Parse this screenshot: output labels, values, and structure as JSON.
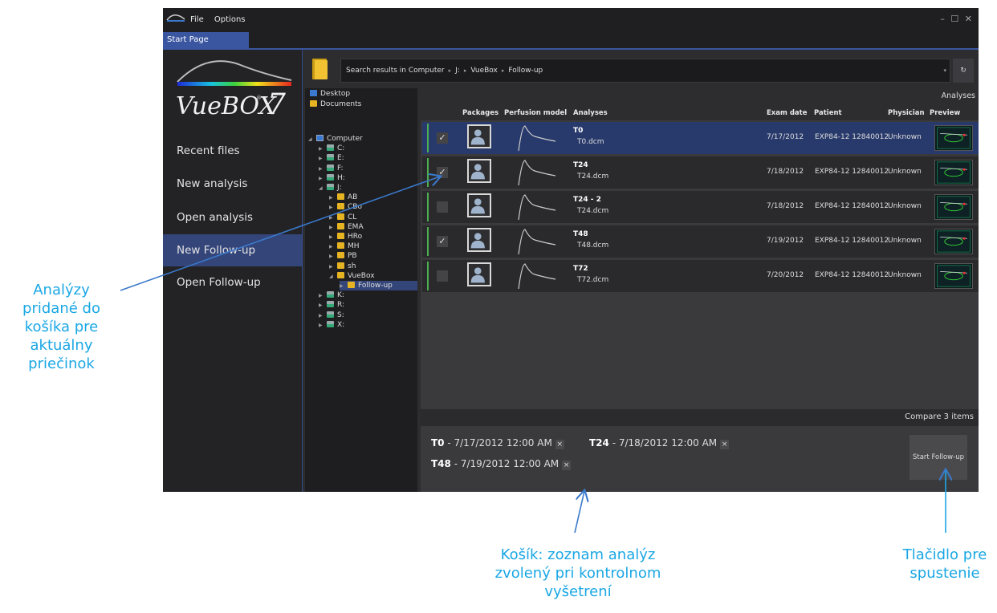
{
  "app": {
    "menu": [
      "File",
      "Options"
    ],
    "window_controls": "– ☐ ✕",
    "tab": "Start Page"
  },
  "brand": {
    "name": "VueBOX",
    "version": "7",
    "registered": "®"
  },
  "nav": {
    "items": [
      "Recent files",
      "New analysis",
      "Open analysis",
      "New Follow-up",
      "Open Follow-up"
    ],
    "active": "New Follow-up"
  },
  "path": {
    "segments": [
      "Search results in Computer",
      "J:",
      "VueBox",
      "Follow-up"
    ],
    "dropdown_glyph": "▾",
    "refresh_glyph": "↻"
  },
  "tree": {
    "items": [
      {
        "label": "Desktop",
        "icon": "desktop-icon",
        "level": 0,
        "arrow": ""
      },
      {
        "label": "Documents",
        "icon": "folder-icon",
        "level": 0,
        "arrow": ""
      },
      {
        "label": "Computer",
        "icon": "computer-icon",
        "level": 0,
        "arrow": "◢"
      },
      {
        "label": "C:",
        "icon": "drive-icon",
        "level": 1,
        "arrow": "▶"
      },
      {
        "label": "E:",
        "icon": "disc-icon",
        "level": 1,
        "arrow": "▶"
      },
      {
        "label": "F:",
        "icon": "drive-icon",
        "level": 1,
        "arrow": "▶"
      },
      {
        "label": "H:",
        "icon": "network-drive-icon",
        "level": 1,
        "arrow": "▶"
      },
      {
        "label": "J:",
        "icon": "network-drive-icon",
        "level": 1,
        "arrow": "◢"
      },
      {
        "label": "AB",
        "icon": "folder-icon",
        "level": 2,
        "arrow": "▶"
      },
      {
        "label": "CBo",
        "icon": "folder-icon",
        "level": 2,
        "arrow": "▶"
      },
      {
        "label": "CL",
        "icon": "folder-icon",
        "level": 2,
        "arrow": "▶"
      },
      {
        "label": "EMA",
        "icon": "folder-icon",
        "level": 2,
        "arrow": "▶"
      },
      {
        "label": "HRo",
        "icon": "folder-icon",
        "level": 2,
        "arrow": "▶"
      },
      {
        "label": "MH",
        "icon": "folder-icon",
        "level": 2,
        "arrow": "▶"
      },
      {
        "label": "PB",
        "icon": "folder-icon",
        "level": 2,
        "arrow": "▶"
      },
      {
        "label": "sh",
        "icon": "folder-icon",
        "level": 2,
        "arrow": "▶"
      },
      {
        "label": "VueBox",
        "icon": "folder-icon",
        "level": 2,
        "arrow": "◢"
      },
      {
        "label": "Follow-up",
        "icon": "folder-icon",
        "level": 3,
        "arrow": "▶",
        "selected": true
      },
      {
        "label": "K:",
        "icon": "network-drive-icon",
        "level": 1,
        "arrow": "▶"
      },
      {
        "label": "R:",
        "icon": "network-drive-icon",
        "level": 1,
        "arrow": "▶"
      },
      {
        "label": "S:",
        "icon": "network-drive-icon",
        "level": 1,
        "arrow": "▶"
      },
      {
        "label": "X:",
        "icon": "network-drive-icon",
        "level": 1,
        "arrow": "▶"
      }
    ]
  },
  "analyses": {
    "section_title": "Analyses",
    "columns": [
      "Packages",
      "Perfusion model",
      "Analyses",
      "Exam date",
      "Patient",
      "Physician",
      "Preview"
    ],
    "rows": [
      {
        "name": "T0",
        "file": "T0.dcm",
        "date": "7/17/2012",
        "patient": "EXP84-12 12840012",
        "physician": "Unknown",
        "checked": true,
        "selected": true
      },
      {
        "name": "T24",
        "file": "T24.dcm",
        "date": "7/18/2012",
        "patient": "EXP84-12 12840012",
        "physician": "Unknown",
        "checked": true,
        "selected": false
      },
      {
        "name": "T24 - 2",
        "file": "T24.dcm",
        "date": "7/18/2012",
        "patient": "EXP84-12 12840012",
        "physician": "Unknown",
        "checked": false,
        "selected": false
      },
      {
        "name": "T48",
        "file": "T48.dcm",
        "date": "7/19/2012",
        "patient": "EXP84-12 12840012",
        "physician": "Unknown",
        "checked": true,
        "selected": false
      },
      {
        "name": "T72",
        "file": "T72.dcm",
        "date": "7/20/2012",
        "patient": "EXP84-12 12840012",
        "physician": "Unknown",
        "checked": false,
        "selected": false
      }
    ]
  },
  "basket": {
    "title": "Compare 3 items",
    "items": [
      {
        "name": "T0",
        "date": " - 7/17/2012 12:00 AM"
      },
      {
        "name": "T24",
        "date": " - 7/18/2012 12:00 AM"
      },
      {
        "name": "T48",
        "date": " - 7/19/2012 12:00 AM"
      }
    ],
    "remove_glyph": "×",
    "start_button": "Start Follow-up"
  },
  "annotations": {
    "left": [
      "Analýzy",
      "pridané do",
      "košíka pre",
      "aktuálny",
      "priečinok"
    ],
    "bottom": [
      "Košík: zoznam analýz",
      "zvolený pri kontrolnom",
      "vyšetrení"
    ],
    "right": [
      "Tlačidlo pre",
      "spustenie"
    ]
  },
  "colors": {
    "accent": "#3a56a0",
    "nav_active": "#34457a",
    "row_selected": "#283a6c",
    "annotation": "#1aa7e4",
    "checked_bar": "#4caf50"
  }
}
